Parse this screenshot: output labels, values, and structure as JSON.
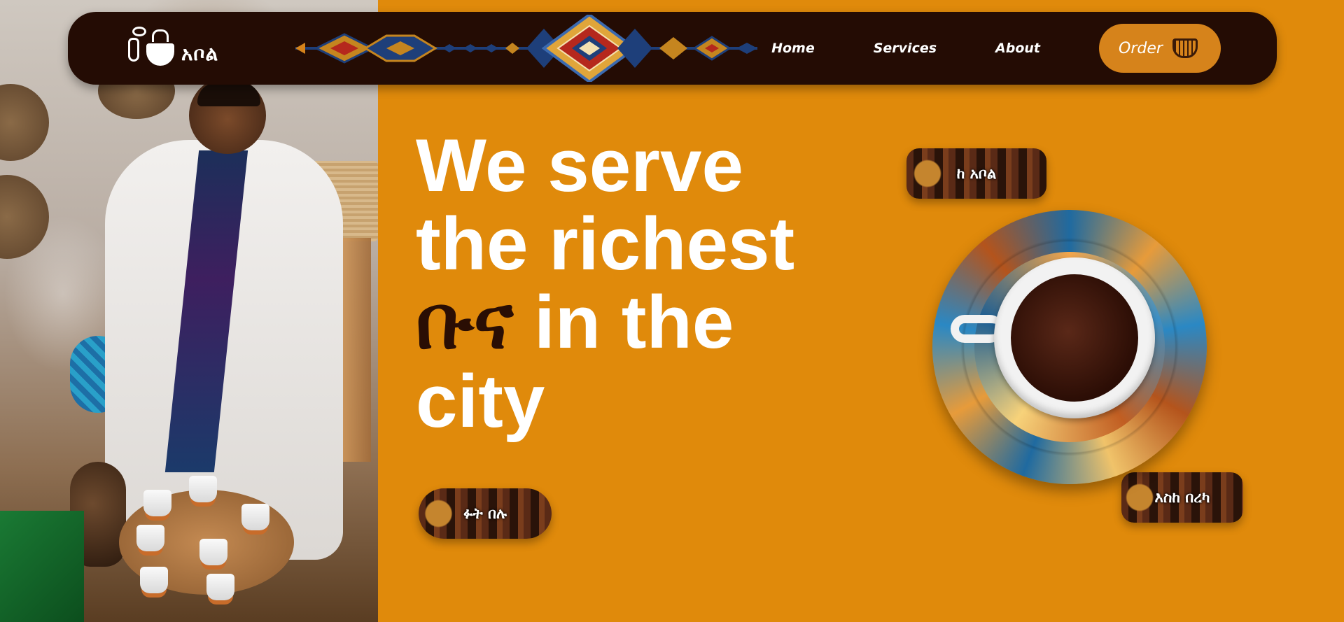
{
  "brand": {
    "name": "አቦል"
  },
  "nav": {
    "items": [
      {
        "label": "Home"
      },
      {
        "label": "Services"
      },
      {
        "label": "About"
      }
    ],
    "order_label": "Order"
  },
  "hero": {
    "line1": "We serve",
    "line2": "the richest",
    "accent": "ቡና",
    "line3_rest": " in the",
    "line4": "city",
    "cta_label": "ፉት በሉ"
  },
  "badges": {
    "top": "ከ አቦል",
    "bottom": "እስከ በረካ"
  },
  "colors": {
    "background": "#e08a0b",
    "nav": "#240c04",
    "accent_text": "#2a0e04",
    "order_button": "#d6831b"
  }
}
